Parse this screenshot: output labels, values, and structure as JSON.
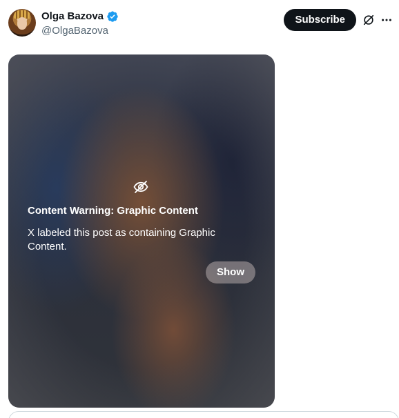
{
  "author": {
    "display_name": "Olga Bazova",
    "handle": "@OlgaBazova",
    "verified_icon": "verified-badge-icon",
    "verified_color": "#1d9bf0"
  },
  "header_actions": {
    "subscribe_label": "Subscribe",
    "grok_icon": "grok-icon",
    "more_icon": "more-options-icon"
  },
  "media": {
    "warning_icon": "eye-off-icon",
    "warning_title": "Content Warning: Graphic Content",
    "warning_description": "X labeled this post as containing Graphic Content.",
    "show_label": "Show"
  },
  "colors": {
    "text_primary": "#0f1419",
    "text_secondary": "#536471",
    "button_dark": "#0f1419",
    "border": "#cfd9de"
  }
}
